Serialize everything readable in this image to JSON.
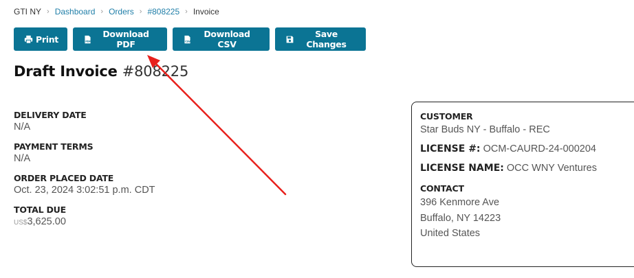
{
  "breadcrumb": {
    "root": "GTI NY",
    "items": [
      "Dashboard",
      "Orders",
      "#808225"
    ],
    "current": "Invoice"
  },
  "toolbar": {
    "print": "Print",
    "download_pdf": "Download PDF",
    "download_csv": "Download CSV",
    "save": "Save Changes"
  },
  "heading": {
    "title": "Draft Invoice",
    "number": "#808225"
  },
  "details": {
    "delivery_date_label": "DELIVERY DATE",
    "delivery_date": "N/A",
    "payment_terms_label": "PAYMENT TERMS",
    "payment_terms": "N/A",
    "order_placed_label": "ORDER PLACED DATE",
    "order_placed": "Oct. 23, 2024 3:02:51 p.m. CDT",
    "total_due_label": "TOTAL DUE",
    "currency": "US$",
    "total_due": "3,625.00"
  },
  "customer": {
    "label": "CUSTOMER",
    "name": "Star Buds NY - Buffalo - REC",
    "license_no_label": "LICENSE #:",
    "license_no": "OCM-CAURD-24-000204",
    "license_name_label": "LICENSE NAME:",
    "license_name": "OCC WNY Ventures",
    "contact_label": "CONTACT",
    "address_lines": [
      "396 Kenmore Ave",
      "Buffalo, NY 14223",
      "United States"
    ]
  },
  "colors": {
    "primary_button": "#0b7494",
    "link": "#1f7ea8",
    "annotation_arrow": "#e8201c"
  },
  "icons": {
    "print": "printer-icon",
    "download_pdf": "pdf-file-icon",
    "download_csv": "csv-file-icon",
    "save": "floppy-disk-icon",
    "separator": "chevron-right-icon"
  }
}
